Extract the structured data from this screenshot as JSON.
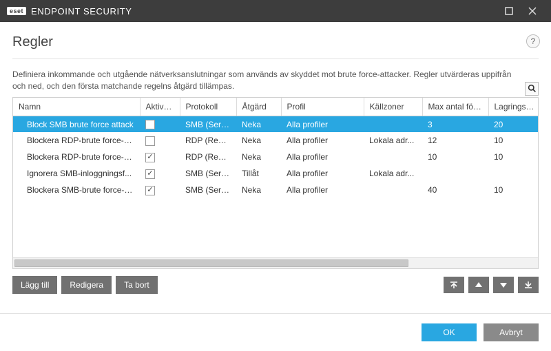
{
  "window": {
    "brand_badge": "eset",
    "brand_title": "ENDPOINT SECURITY"
  },
  "page": {
    "title": "Regler",
    "help_label": "?",
    "description": "Definiera inkommande och utgående nätverksanslutningar som används av skyddet mot brute force-attacker. Regler utvärderas uppifrån och ned, och den första matchande regelns åtgärd tillämpas."
  },
  "columns": {
    "name": "Namn",
    "enabled": "Aktiverat",
    "protocol": "Protokoll",
    "action": "Åtgärd",
    "profile": "Profil",
    "zones": "Källzoner",
    "max_attempts": "Max antal försök",
    "retention": "Lagringspe..."
  },
  "rows": [
    {
      "name": "Block SMB brute force attack",
      "enabled": false,
      "protocol": "SMB (Serv...",
      "action": "Neka",
      "profile": "Alla profiler",
      "zones": "",
      "max_attempts": "3",
      "retention": "20",
      "selected": true
    },
    {
      "name": "Blockera RDP-brute force-at...",
      "enabled": false,
      "protocol": "RDP (Rem...",
      "action": "Neka",
      "profile": "Alla profiler",
      "zones": "Lokala adr...",
      "max_attempts": "12",
      "retention": "10",
      "selected": false
    },
    {
      "name": "Blockera RDP-brute force-at...",
      "enabled": true,
      "protocol": "RDP (Rem...",
      "action": "Neka",
      "profile": "Alla profiler",
      "zones": "",
      "max_attempts": "10",
      "retention": "10",
      "selected": false
    },
    {
      "name": "Ignorera SMB-inloggningsf...",
      "enabled": true,
      "protocol": "SMB (Serv...",
      "action": "Tillåt",
      "profile": "Alla profiler",
      "zones": "Lokala adr...",
      "max_attempts": "",
      "retention": "",
      "selected": false
    },
    {
      "name": "Blockera SMB-brute force-a...",
      "enabled": true,
      "protocol": "SMB (Serv...",
      "action": "Neka",
      "profile": "Alla profiler",
      "zones": "",
      "max_attempts": "40",
      "retention": "10",
      "selected": false
    }
  ],
  "toolbar": {
    "add": "Lägg till",
    "edit": "Redigera",
    "delete": "Ta bort"
  },
  "footer": {
    "ok": "OK",
    "cancel": "Avbryt"
  }
}
